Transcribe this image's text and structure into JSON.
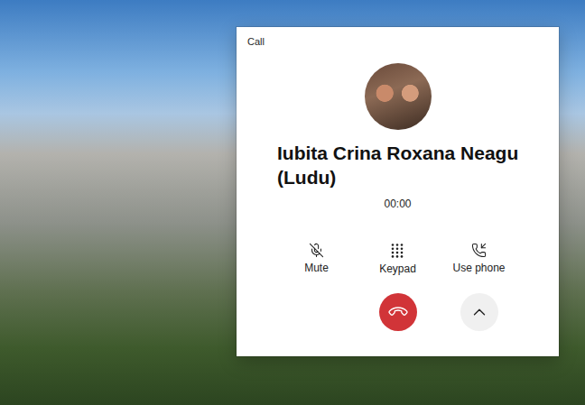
{
  "window": {
    "title": "Call"
  },
  "contact": {
    "name": "Iubita Crina Roxana Neagu (Ludu)"
  },
  "timer": "00:00",
  "actions": [
    {
      "label": "Mute",
      "kind": "mute"
    },
    {
      "label": "Keypad",
      "kind": "keypad"
    },
    {
      "label": "Use phone",
      "kind": "phone"
    }
  ]
}
